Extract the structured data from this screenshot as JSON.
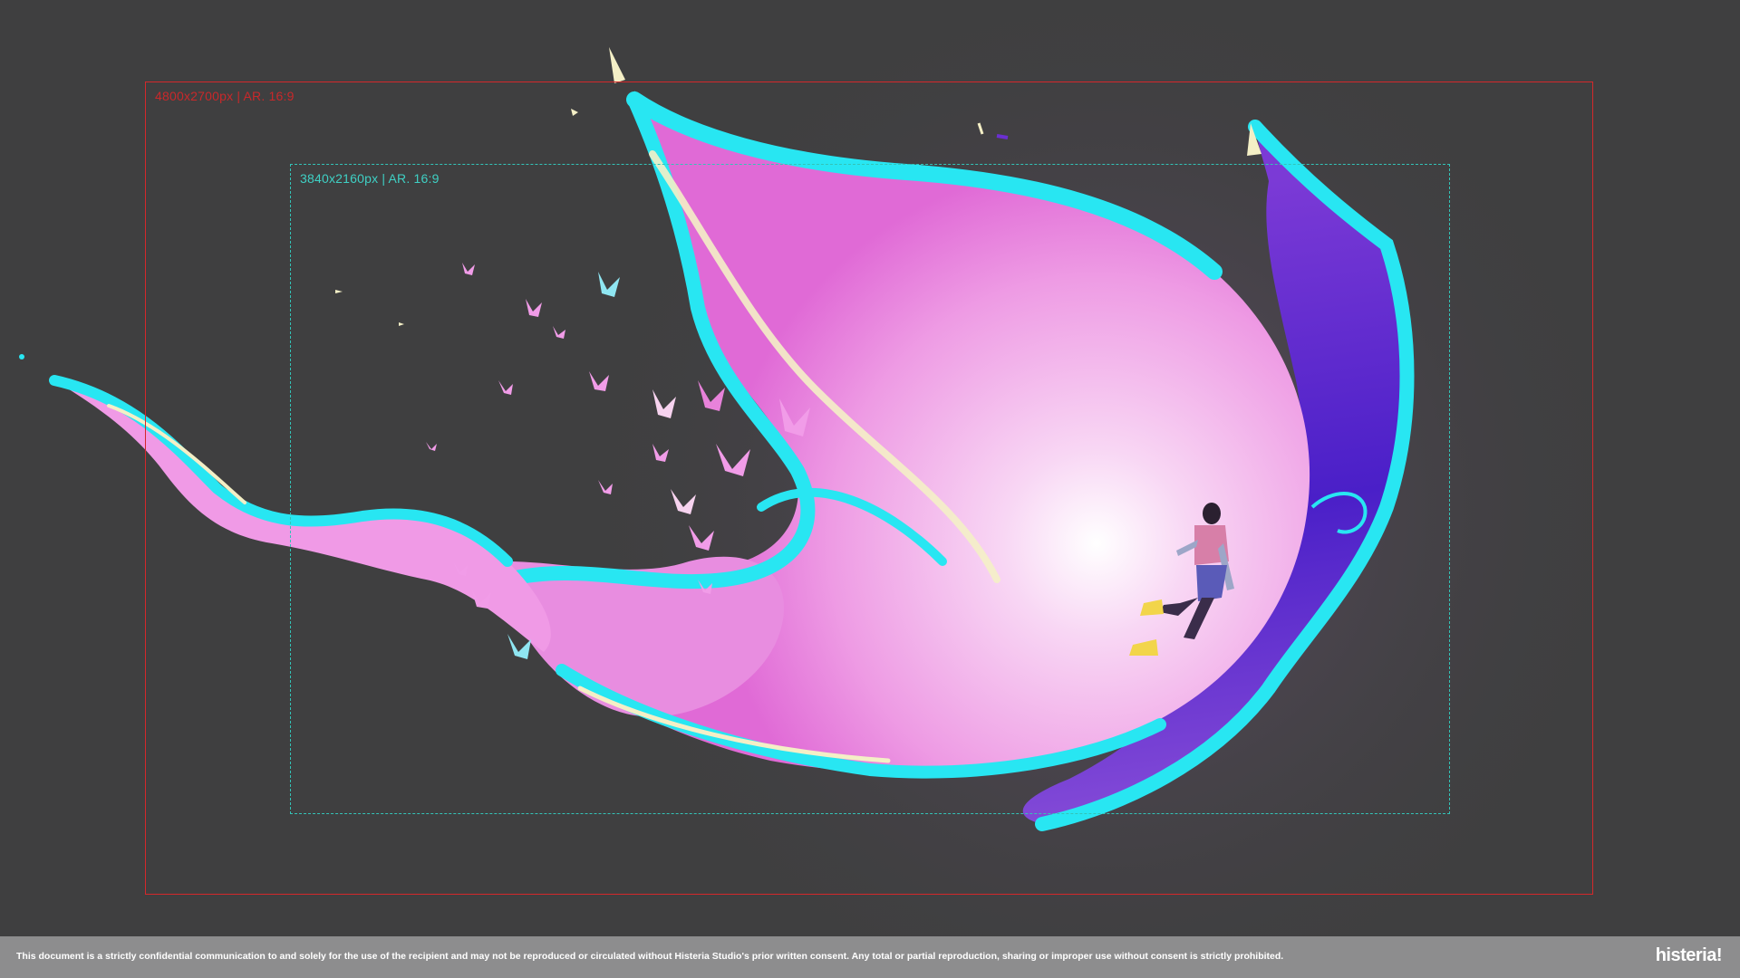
{
  "frames": {
    "outer_label": "4800x2700px | AR. 16:9",
    "inner_label": "3840x2160px | AR. 16:9"
  },
  "artwork": {
    "subject": "character-in-butterfly-wing-effect",
    "colors": {
      "background": "#3f3f40",
      "cyan": "#28e6f2",
      "pink": "#f19ce8",
      "magenta": "#e76ad9",
      "violet": "#6b2fd1",
      "cream": "#f4efc6",
      "outer_frame": "#d4282b",
      "inner_frame": "#33c3b7"
    }
  },
  "footer": {
    "disclaimer": "This document is a strictly confidential communication to and solely for the use of the recipient and may not be reproduced or circulated without Histeria Studio's prior written consent. Any total or partial reproduction, sharing or improper use without consent is strictly prohibited.",
    "logo": "histeria!"
  }
}
